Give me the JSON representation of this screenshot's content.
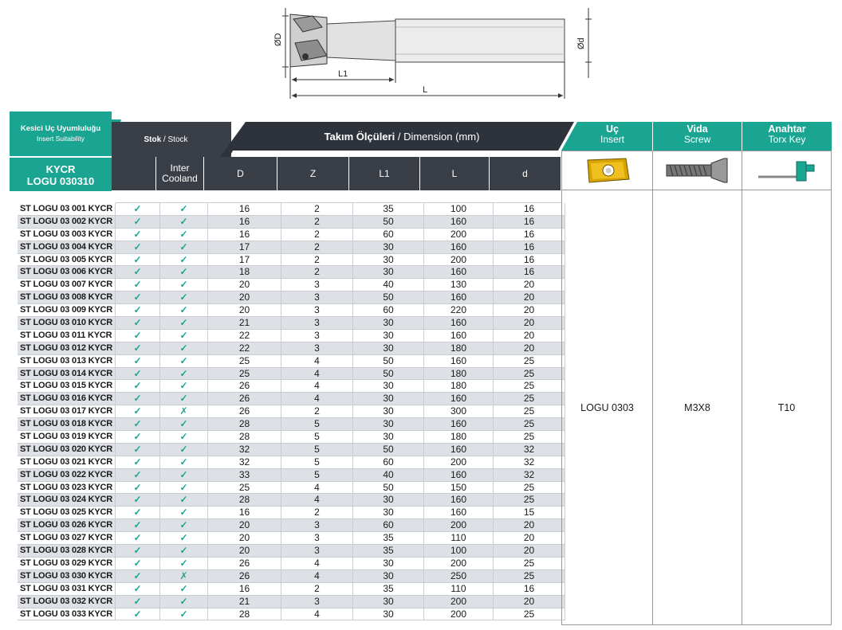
{
  "drawing": {
    "label_D": "ØD",
    "label_d": "Ød",
    "label_L1": "L1",
    "label_L": "L"
  },
  "header": {
    "suitability_title": "Kesici Uç Uyumluluğu",
    "suitability_sub": "Insert Suitability",
    "series_line1": "KYCR",
    "series_line2": "LOGU 030310",
    "stock_tr": "Stok",
    "stock_en": "Stock",
    "dimension_tr": "Takım Ölçüleri",
    "dimension_en": "Dimension (mm)",
    "insert_tr": "Uç",
    "insert_en": "Insert",
    "screw_tr": "Vida",
    "screw_en": "Screw",
    "key_tr": "Anahtar",
    "key_en": "Torx Key"
  },
  "columns": [
    "Inter Cooland",
    "D",
    "Z",
    "L1",
    "L",
    "d"
  ],
  "accessories": {
    "insert": "LOGU 0303",
    "screw": "M3X8",
    "key": "T10"
  },
  "icons": {
    "check": "✓",
    "cross": "✗"
  },
  "colors": {
    "accent": "#1aa592",
    "header_dark": "#2e333b",
    "row_alt": "#dde0e4"
  },
  "rows": [
    {
      "code": "ST LOGU 03 001 KYCR",
      "stock": "✓",
      "cool": "✓",
      "D": "16",
      "Z": "2",
      "L1": "35",
      "L": "100",
      "d": "16"
    },
    {
      "code": "ST LOGU 03 002 KYCR",
      "stock": "✓",
      "cool": "✓",
      "D": "16",
      "Z": "2",
      "L1": "50",
      "L": "160",
      "d": "16"
    },
    {
      "code": "ST LOGU 03 003 KYCR",
      "stock": "✓",
      "cool": "✓",
      "D": "16",
      "Z": "2",
      "L1": "60",
      "L": "200",
      "d": "16"
    },
    {
      "code": "ST LOGU 03 004 KYCR",
      "stock": "✓",
      "cool": "✓",
      "D": "17",
      "Z": "2",
      "L1": "30",
      "L": "160",
      "d": "16"
    },
    {
      "code": "ST LOGU 03 005 KYCR",
      "stock": "✓",
      "cool": "✓",
      "D": "17",
      "Z": "2",
      "L1": "30",
      "L": "200",
      "d": "16"
    },
    {
      "code": "ST LOGU 03 006 KYCR",
      "stock": "✓",
      "cool": "✓",
      "D": "18",
      "Z": "2",
      "L1": "30",
      "L": "160",
      "d": "16"
    },
    {
      "code": "ST LOGU 03 007 KYCR",
      "stock": "✓",
      "cool": "✓",
      "D": "20",
      "Z": "3",
      "L1": "40",
      "L": "130",
      "d": "20"
    },
    {
      "code": "ST LOGU 03 008 KYCR",
      "stock": "✓",
      "cool": "✓",
      "D": "20",
      "Z": "3",
      "L1": "50",
      "L": "160",
      "d": "20"
    },
    {
      "code": "ST LOGU 03 009 KYCR",
      "stock": "✓",
      "cool": "✓",
      "D": "20",
      "Z": "3",
      "L1": "60",
      "L": "220",
      "d": "20"
    },
    {
      "code": "ST LOGU 03 010 KYCR",
      "stock": "✓",
      "cool": "✓",
      "D": "21",
      "Z": "3",
      "L1": "30",
      "L": "160",
      "d": "20"
    },
    {
      "code": "ST LOGU 03 011 KYCR",
      "stock": "✓",
      "cool": "✓",
      "D": "22",
      "Z": "3",
      "L1": "30",
      "L": "160",
      "d": "20"
    },
    {
      "code": "ST LOGU 03 012 KYCR",
      "stock": "✓",
      "cool": "✓",
      "D": "22",
      "Z": "3",
      "L1": "30",
      "L": "180",
      "d": "20"
    },
    {
      "code": "ST LOGU 03 013 KYCR",
      "stock": "✓",
      "cool": "✓",
      "D": "25",
      "Z": "4",
      "L1": "50",
      "L": "160",
      "d": "25"
    },
    {
      "code": "ST LOGU 03 014 KYCR",
      "stock": "✓",
      "cool": "✓",
      "D": "25",
      "Z": "4",
      "L1": "50",
      "L": "180",
      "d": "25"
    },
    {
      "code": "ST LOGU 03 015 KYCR",
      "stock": "✓",
      "cool": "✓",
      "D": "26",
      "Z": "4",
      "L1": "30",
      "L": "180",
      "d": "25"
    },
    {
      "code": "ST LOGU 03 016 KYCR",
      "stock": "✓",
      "cool": "✓",
      "D": "26",
      "Z": "4",
      "L1": "30",
      "L": "160",
      "d": "25"
    },
    {
      "code": "ST LOGU 03 017 KYCR",
      "stock": "✓",
      "cool": "✗",
      "D": "26",
      "Z": "2",
      "L1": "30",
      "L": "300",
      "d": "25"
    },
    {
      "code": "ST LOGU 03 018 KYCR",
      "stock": "✓",
      "cool": "✓",
      "D": "28",
      "Z": "5",
      "L1": "30",
      "L": "160",
      "d": "25"
    },
    {
      "code": "ST LOGU 03 019 KYCR",
      "stock": "✓",
      "cool": "✓",
      "D": "28",
      "Z": "5",
      "L1": "30",
      "L": "180",
      "d": "25"
    },
    {
      "code": "ST LOGU 03 020 KYCR",
      "stock": "✓",
      "cool": "✓",
      "D": "32",
      "Z": "5",
      "L1": "50",
      "L": "160",
      "d": "32"
    },
    {
      "code": "ST LOGU 03 021 KYCR",
      "stock": "✓",
      "cool": "✓",
      "D": "32",
      "Z": "5",
      "L1": "60",
      "L": "200",
      "d": "32"
    },
    {
      "code": "ST LOGU 03 022 KYCR",
      "stock": "✓",
      "cool": "✓",
      "D": "33",
      "Z": "5",
      "L1": "40",
      "L": "160",
      "d": "32"
    },
    {
      "code": "ST LOGU 03 023 KYCR",
      "stock": "✓",
      "cool": "✓",
      "D": "25",
      "Z": "4",
      "L1": "50",
      "L": "150",
      "d": "25"
    },
    {
      "code": "ST LOGU 03 024 KYCR",
      "stock": "✓",
      "cool": "✓",
      "D": "28",
      "Z": "4",
      "L1": "30",
      "L": "160",
      "d": "25"
    },
    {
      "code": "ST LOGU 03 025 KYCR",
      "stock": "✓",
      "cool": "✓",
      "D": "16",
      "Z": "2",
      "L1": "30",
      "L": "160",
      "d": "15"
    },
    {
      "code": "ST LOGU 03 026 KYCR",
      "stock": "✓",
      "cool": "✓",
      "D": "20",
      "Z": "3",
      "L1": "60",
      "L": "200",
      "d": "20"
    },
    {
      "code": "ST LOGU 03 027 KYCR",
      "stock": "✓",
      "cool": "✓",
      "D": "20",
      "Z": "3",
      "L1": "35",
      "L": "110",
      "d": "20"
    },
    {
      "code": "ST LOGU 03 028 KYCR",
      "stock": "✓",
      "cool": "✓",
      "D": "20",
      "Z": "3",
      "L1": "35",
      "L": "100",
      "d": "20"
    },
    {
      "code": "ST LOGU 03 029 KYCR",
      "stock": "✓",
      "cool": "✓",
      "D": "26",
      "Z": "4",
      "L1": "30",
      "L": "200",
      "d": "25"
    },
    {
      "code": "ST LOGU 03 030 KYCR",
      "stock": "✓",
      "cool": "✗",
      "D": "26",
      "Z": "4",
      "L1": "30",
      "L": "250",
      "d": "25"
    },
    {
      "code": "ST LOGU 03 031 KYCR",
      "stock": "✓",
      "cool": "✓",
      "D": "16",
      "Z": "2",
      "L1": "35",
      "L": "110",
      "d": "16"
    },
    {
      "code": "ST LOGU 03 032 KYCR",
      "stock": "✓",
      "cool": "✓",
      "D": "21",
      "Z": "3",
      "L1": "30",
      "L": "200",
      "d": "20"
    },
    {
      "code": "ST LOGU 03 033 KYCR",
      "stock": "✓",
      "cool": "✓",
      "D": "28",
      "Z": "4",
      "L1": "30",
      "L": "200",
      "d": "25"
    }
  ]
}
